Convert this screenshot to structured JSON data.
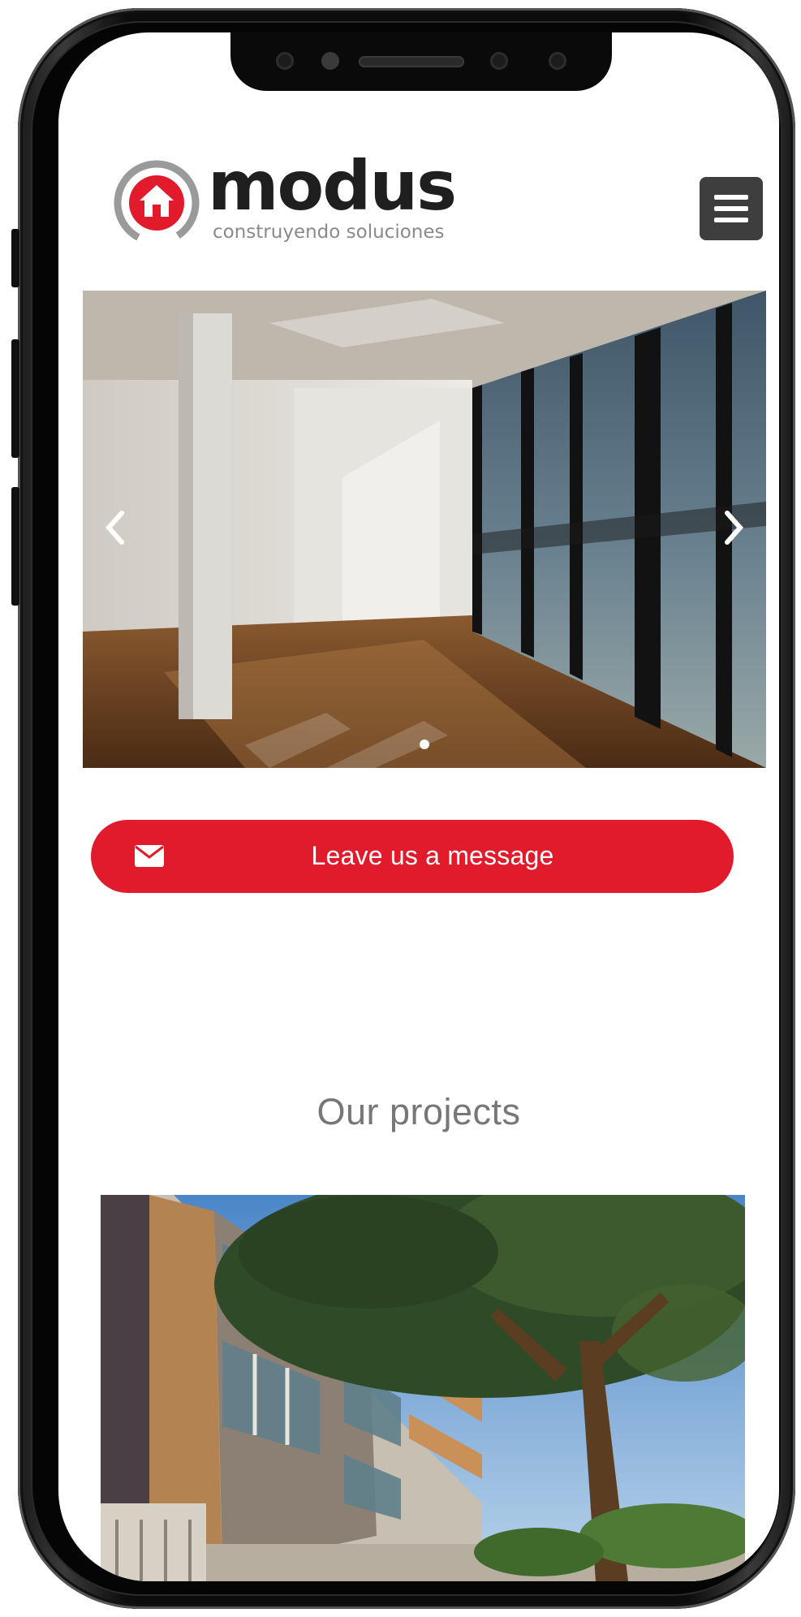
{
  "header": {
    "brand_name": "modus",
    "brand_tagline": "construyendo soluciones"
  },
  "hero": {
    "slide_count": 1,
    "active_slide": 1
  },
  "cta": {
    "label": "Leave us a message"
  },
  "projects": {
    "title": "Our projects"
  },
  "colors": {
    "accent": "#e11b2b",
    "menu_button": "#3e3e3e",
    "title_text": "#777777"
  }
}
